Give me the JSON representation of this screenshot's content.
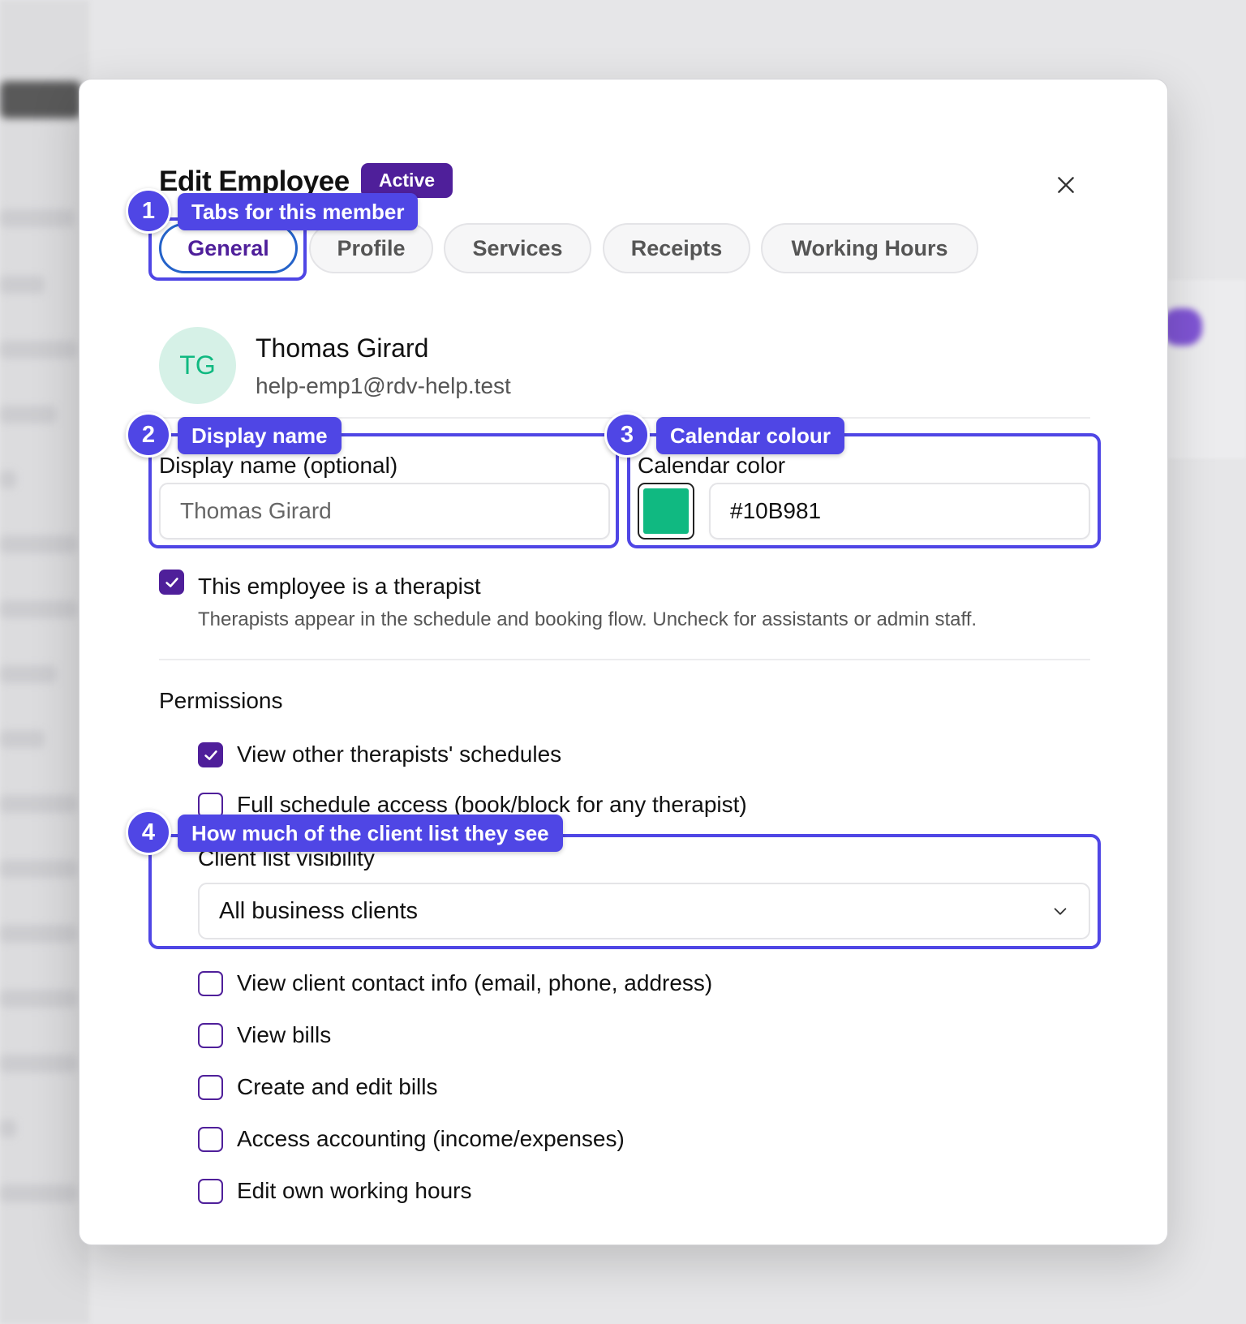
{
  "modal": {
    "title": "Edit Employee",
    "status_badge": "Active",
    "close_icon": "close-icon"
  },
  "tabs": [
    {
      "label": "General",
      "active": true
    },
    {
      "label": "Profile",
      "active": false
    },
    {
      "label": "Services",
      "active": false
    },
    {
      "label": "Receipts",
      "active": false
    },
    {
      "label": "Working Hours",
      "active": false
    }
  ],
  "employee": {
    "initials": "TG",
    "name": "Thomas Girard",
    "email": "help-emp1@rdv-help.test"
  },
  "display_name": {
    "label": "Display name (optional)",
    "placeholder": "Thomas Girard"
  },
  "calendar_color": {
    "label": "Calendar color",
    "value": "#10B981"
  },
  "therapist": {
    "checked": true,
    "label": "This employee is a therapist",
    "help": "Therapists appear in the schedule and booking flow. Uncheck for assistants or admin staff."
  },
  "permissions": {
    "heading": "Permissions",
    "items": [
      {
        "label": "View other therapists' schedules",
        "checked": true
      },
      {
        "label": "Full schedule access (book/block for any therapist)",
        "checked": false
      }
    ],
    "client_list": {
      "label": "Client list visibility",
      "selected": "All business clients"
    },
    "more_items": [
      {
        "label": "View client contact info (email, phone, address)",
        "checked": false
      },
      {
        "label": "View bills",
        "checked": false
      },
      {
        "label": "Create and edit bills",
        "checked": false
      },
      {
        "label": "Access accounting (income/expenses)",
        "checked": false
      },
      {
        "label": "Edit own working hours",
        "checked": false
      }
    ]
  },
  "annotations": [
    {
      "number": "1",
      "label": "Tabs for this member"
    },
    {
      "number": "2",
      "label": "Display name"
    },
    {
      "number": "3",
      "label": "Calendar colour"
    },
    {
      "number": "4",
      "label": "How much of the client list they see"
    }
  ],
  "colors": {
    "accent": "#4F1F9A",
    "annotation": "#4F46E5",
    "calendar_swatch": "#10B981",
    "tab_focus": "#2563C9"
  }
}
